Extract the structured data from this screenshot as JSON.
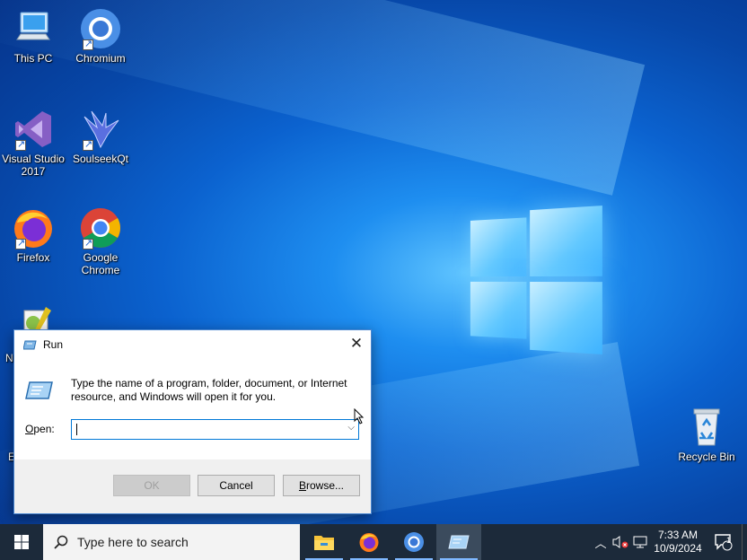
{
  "desktop": {
    "icons": [
      {
        "label": "This PC",
        "name": "this-pc"
      },
      {
        "label": "Chromium",
        "name": "chromium"
      },
      {
        "label": "Visual Studio 2017",
        "name": "visual-studio-2017"
      },
      {
        "label": "SoulseekQt",
        "name": "soulseekqt"
      },
      {
        "label": "Firefox",
        "name": "firefox"
      },
      {
        "label": "Google Chrome",
        "name": "google-chrome"
      },
      {
        "label": "N",
        "name": "notepad-plus-plus-partial"
      },
      {
        "label": "E",
        "name": "partial-icon-e"
      },
      {
        "label": "Recycle Bin",
        "name": "recycle-bin"
      }
    ]
  },
  "run_dialog": {
    "title": "Run",
    "description": "Type the name of a program, folder, document, or Internet resource, and Windows will open it for you.",
    "open_label_prefix": "",
    "open_label_accel": "O",
    "open_label_rest": "pen:",
    "open_value": "",
    "ok_label": "OK",
    "cancel_label": "Cancel",
    "browse_label": "Browse..."
  },
  "taskbar": {
    "search_placeholder": "Type here to search",
    "time": "7:33 AM",
    "date": "10/9/2024",
    "notification_count": "1",
    "apps": [
      "file-explorer",
      "firefox",
      "chromium",
      "run"
    ]
  }
}
